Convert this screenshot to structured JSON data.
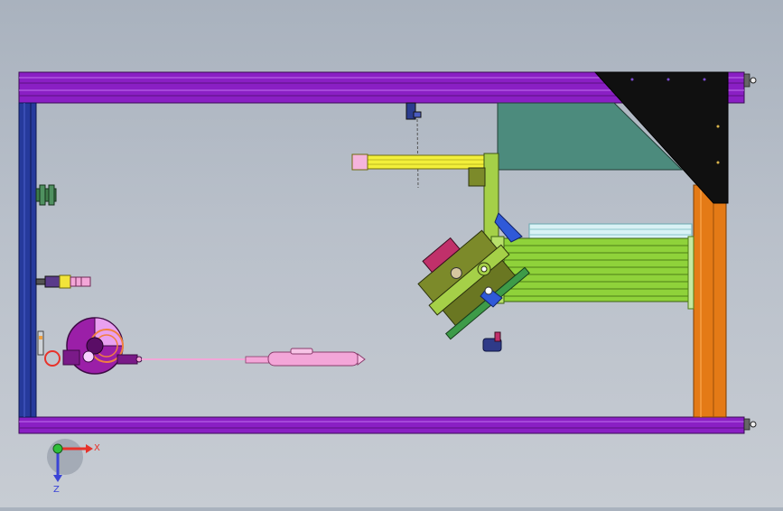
{
  "view": {
    "background_top": "#a9b2be",
    "background_bottom": "#c7ccd3"
  },
  "triad": {
    "x_label": "X",
    "y_label": "Z",
    "x_color": "#e8322a",
    "y_color": "#3a44d6",
    "origin_color": "#2fbf3a"
  },
  "colors": {
    "frame_purple": "#8a1fc4",
    "frame_blue": "#263a9c",
    "orange_post": "#e47a16",
    "black_gusset": "#101010",
    "teal_panel": "#4c8b7d",
    "yellow_arm": "#f2ef3a",
    "green_assembly": "#8fd23a",
    "olive_bracket": "#7c8a2a",
    "pink_probe": "#f3a6d8",
    "magenta_spindle": "#9b1fa8"
  },
  "icons": [
    "coordinate-triad-icon",
    "clamp-fixture-icon",
    "sensor-fixture-icon",
    "spindle-motor-icon",
    "probe-tool-icon"
  ]
}
